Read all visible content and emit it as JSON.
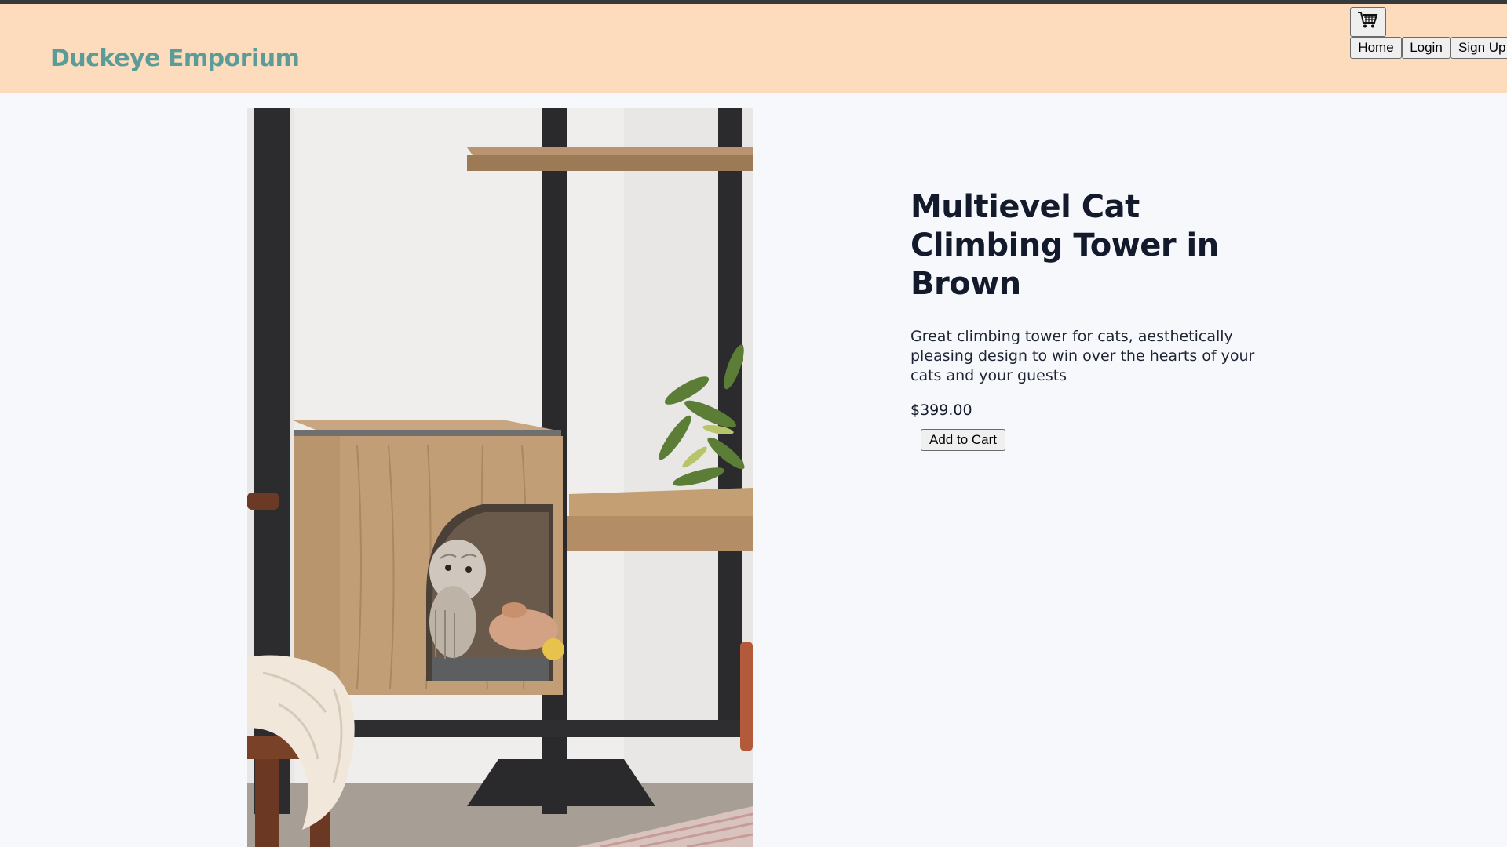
{
  "header": {
    "brand": "Duckeye Emporium",
    "nav": {
      "home": "Home",
      "login": "Login",
      "signup": "Sign Up"
    },
    "cart_icon": "shopping-cart-icon"
  },
  "product": {
    "image_alt": "Multilevel wooden cat climbing tower with a kitten inside the cube",
    "title": "Multievel Cat Climbing Tower in Brown",
    "description": "Great climbing tower for cats, aesthetically pleasing design to win over the hearts of your cats and your guests",
    "price": "$399.00",
    "add_to_cart": "Add to Cart"
  },
  "colors": {
    "header_bg": "#fcdcbc",
    "brand": "#5c9c98",
    "page_bg": "#f7f8fb",
    "title": "#121a2c"
  }
}
